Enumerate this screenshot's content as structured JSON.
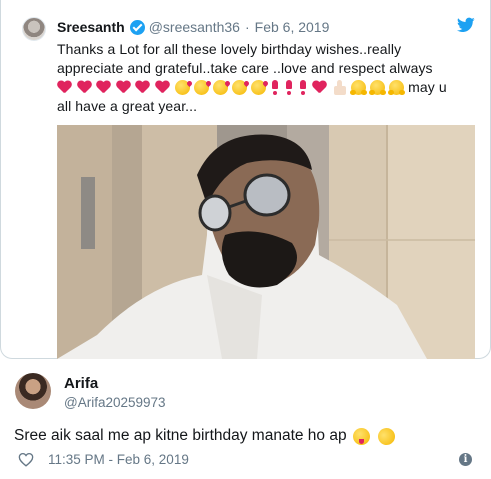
{
  "quoted_tweet": {
    "author_name": "Sreesanth",
    "author_handle": "@sreesanth36",
    "separator": "·",
    "date": "Feb 6, 2019",
    "text_line1": "Thanks a Lot for all these lovely birthday wishes..really",
    "text_line2": "appreciate and grateful..take care ..love and respect always",
    "text_line3_suffix": "may u",
    "text_line4": "all have a great year...",
    "emoji_names": [
      "red-heart",
      "red-heart",
      "red-heart",
      "red-heart",
      "red-heart",
      "red-heart",
      "face-blowing-kiss",
      "face-blowing-kiss",
      "face-blowing-kiss",
      "face-blowing-kiss",
      "face-blowing-kiss",
      "heart-exclamation",
      "heart-exclamation",
      "heart-exclamation",
      "red-heart",
      "thumbs-up",
      "hugging-face",
      "hugging-face",
      "hugging-face"
    ],
    "photo_icon": "selfie-photo"
  },
  "reply_tweet": {
    "author_name": "Arifa",
    "author_handle": "@Arifa20259973",
    "text": "Sree aik saal me ap kitne birthday manate ho ap",
    "text_emoji": [
      "winking-face-tongue",
      "rolling-on-floor-laughing"
    ],
    "time": "11:35 PM - Feb 6, 2019",
    "info_glyph": "i"
  },
  "colors": {
    "twitter_blue": "#1da1f2",
    "secondary_text": "#657786",
    "heart_red": "#e0245e",
    "border": "#cfd9de"
  }
}
